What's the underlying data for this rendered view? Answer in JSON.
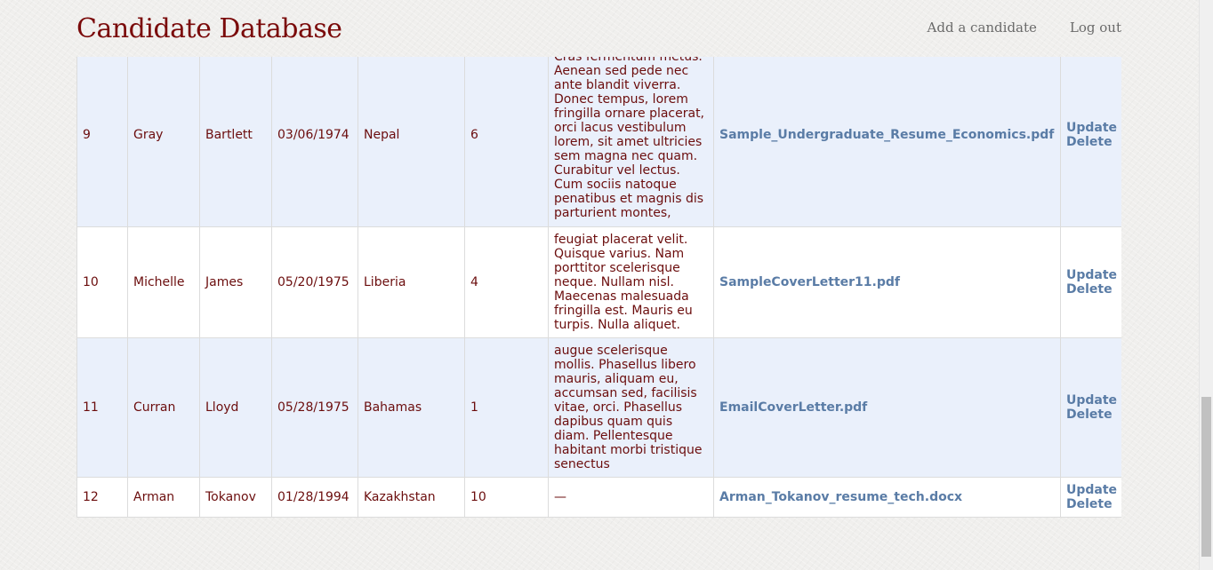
{
  "header": {
    "title": "Candidate Database",
    "nav": {
      "add_candidate": "Add a candidate",
      "logout": "Log out"
    }
  },
  "table": {
    "rows": [
      {
        "id": "9",
        "first_name": "Gray",
        "last_name": "Bartlett",
        "dob": "03/06/1974",
        "country": "Nepal",
        "experience": "6",
        "bio": "Cras fermentum metus. Aenean sed pede nec ante blandit viverra. Donec tempus, lorem fringilla ornare placerat, orci lacus vestibulum lorem, sit amet ultricies sem magna nec quam. Curabitur vel lectus. Cum sociis natoque penatibus et magnis dis parturient montes,",
        "file": "Sample_Undergraduate_Resume_Economics.pdf",
        "update": "Update",
        "delete": "Delete"
      },
      {
        "id": "10",
        "first_name": "Michelle",
        "last_name": "James",
        "dob": "05/20/1975",
        "country": "Liberia",
        "experience": "4",
        "bio": "feugiat placerat velit. Quisque varius. Nam porttitor scelerisque neque. Nullam nisl. Maecenas malesuada fringilla est. Mauris eu turpis. Nulla aliquet.",
        "file": "SampleCoverLetter11.pdf",
        "update": "Update",
        "delete": "Delete"
      },
      {
        "id": "11",
        "first_name": "Curran",
        "last_name": "Lloyd",
        "dob": "05/28/1975",
        "country": "Bahamas",
        "experience": "1",
        "bio": "augue scelerisque mollis. Phasellus libero mauris, aliquam eu, accumsan sed, facilisis vitae, orci. Phasellus dapibus quam quis diam. Pellentesque habitant morbi tristique senectus",
        "file": "EmailCoverLetter.pdf",
        "update": "Update",
        "delete": "Delete"
      },
      {
        "id": "12",
        "first_name": "Arman",
        "last_name": "Tokanov",
        "dob": "01/28/1994",
        "country": "Kazakhstan",
        "experience": "10",
        "bio": "—",
        "file": "Arman_Tokanov_resume_tech.docx",
        "update": "Update",
        "delete": "Delete"
      }
    ]
  },
  "colors": {
    "title": "#7a0a0a",
    "cell_text": "#6b0d0d",
    "link": "#5a7ca6",
    "row_alt": "#eaf0fb"
  }
}
